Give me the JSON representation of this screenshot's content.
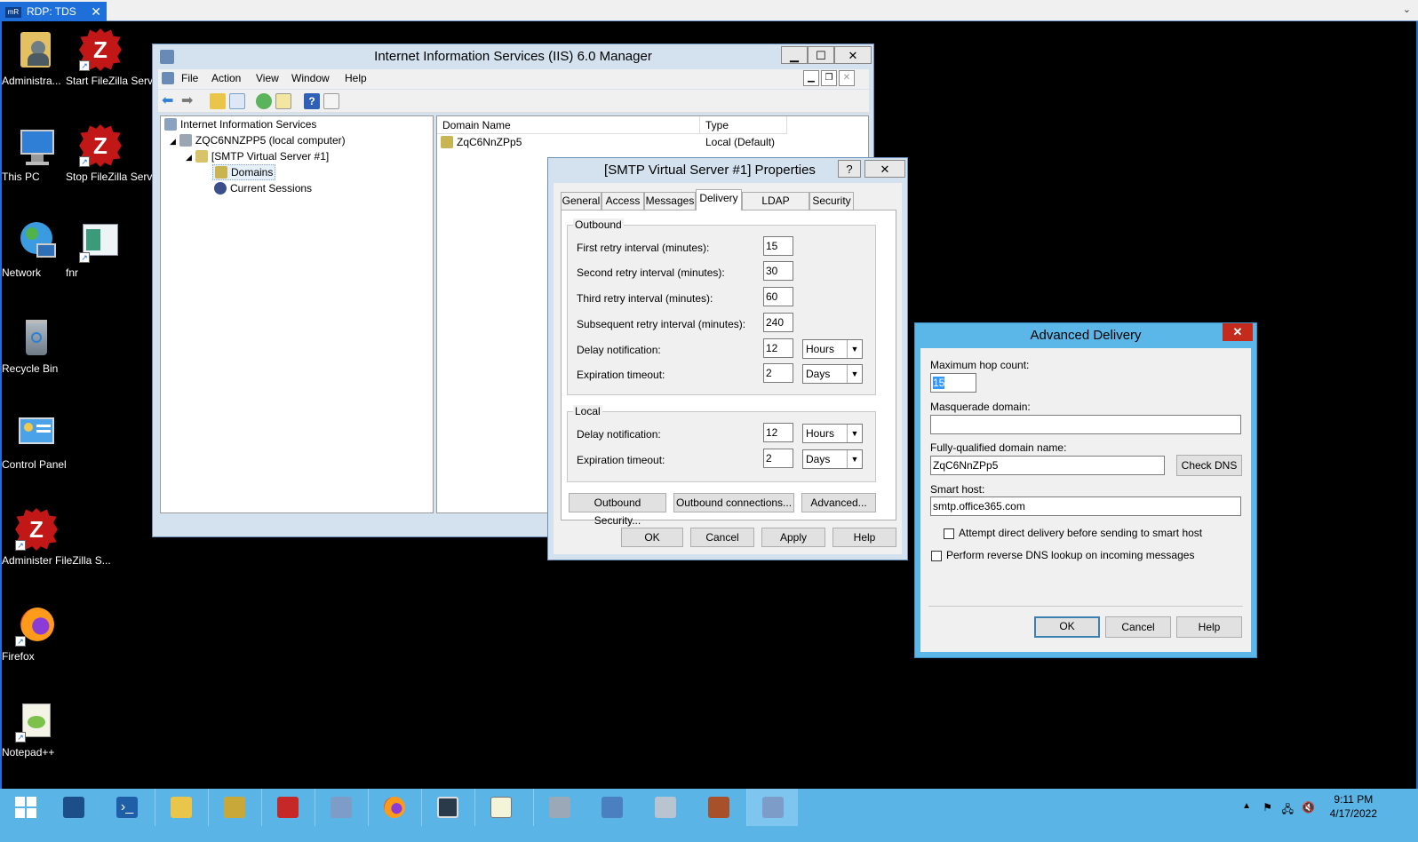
{
  "rdp": {
    "tab_label": "RDP: TDS",
    "logo_text": "mR",
    "close": "✕",
    "chevron": "⌄"
  },
  "desktop_icons": [
    {
      "label": "Administra..."
    },
    {
      "label": "Start FileZilla Server"
    },
    {
      "label": "This PC"
    },
    {
      "label": "Stop FileZilla Server"
    },
    {
      "label": "Network"
    },
    {
      "label": "fnr"
    },
    {
      "label": "Recycle Bin"
    },
    {
      "label": "Control Panel"
    },
    {
      "label": "Administer FileZilla S..."
    },
    {
      "label": "Firefox"
    },
    {
      "label": "Notepad++"
    }
  ],
  "iis": {
    "title": "Internet Information Services (IIS) 6.0 Manager",
    "menu": [
      "File",
      "Action",
      "View",
      "Window",
      "Help"
    ],
    "tree": {
      "root": "Internet Information Services",
      "computer": "ZQC6NNZPP5 (local computer)",
      "server": "[SMTP Virtual Server #1]",
      "domains": "Domains",
      "sessions": "Current Sessions"
    },
    "list": {
      "columns": [
        "Domain Name",
        "Type"
      ],
      "rows": [
        {
          "name": "ZqC6NnZPp5",
          "type": "Local (Default)"
        }
      ]
    }
  },
  "smtp_props": {
    "title": "[SMTP Virtual Server #1] Properties",
    "help_btn": "?",
    "close_btn": "✕",
    "tabs": [
      "General",
      "Access",
      "Messages",
      "Delivery",
      "LDAP Routing",
      "Security"
    ],
    "active_tab": "Delivery",
    "outbound": {
      "title": "Outbound",
      "first_retry_label": "First retry interval (minutes):",
      "first_retry": "15",
      "second_retry_label": "Second retry interval (minutes):",
      "second_retry": "30",
      "third_retry_label": "Third retry interval (minutes):",
      "third_retry": "60",
      "subsequent_retry_label": "Subsequent retry interval (minutes):",
      "subsequent_retry": "240",
      "delay_label": "Delay notification:",
      "delay_value": "12",
      "delay_unit": "Hours",
      "expiration_label": "Expiration timeout:",
      "expiration_value": "2",
      "expiration_unit": "Days"
    },
    "local": {
      "title": "Local",
      "delay_label": "Delay notification:",
      "delay_value": "12",
      "delay_unit": "Hours",
      "expiration_label": "Expiration timeout:",
      "expiration_value": "2",
      "expiration_unit": "Days"
    },
    "buttons": {
      "outbound_security": "Outbound Security...",
      "outbound_connections": "Outbound connections...",
      "advanced": "Advanced...",
      "ok": "OK",
      "cancel": "Cancel",
      "apply": "Apply",
      "help": "Help"
    }
  },
  "advanced_delivery": {
    "title": "Advanced Delivery",
    "close_btn": "✕",
    "max_hop_label": "Maximum hop count:",
    "max_hop": "15",
    "masquerade_label": "Masquerade domain:",
    "masquerade": "",
    "fqdn_label": "Fully-qualified domain name:",
    "fqdn": "ZqC6NnZPp5",
    "check_dns": "Check DNS",
    "smart_host_label": "Smart host:",
    "smart_host": "smtp.office365.com",
    "attempt_direct_label": "Attempt direct delivery before sending to smart host",
    "attempt_direct_checked": false,
    "reverse_dns_label": "Perform reverse DNS lookup on incoming messages",
    "reverse_dns_checked": false,
    "ok": "OK",
    "cancel": "Cancel",
    "help": "Help"
  },
  "taskbar": {
    "apps": [
      "start",
      "server-manager",
      "powershell",
      "file-explorer",
      "tools",
      "toolbox",
      "iis-manager",
      "firefox",
      "remote-desktop",
      "notepad",
      "configuration",
      "network-computer",
      "services",
      "firewall",
      "iis6-manager"
    ],
    "time": "9:11 PM",
    "date": "4/17/2022"
  }
}
